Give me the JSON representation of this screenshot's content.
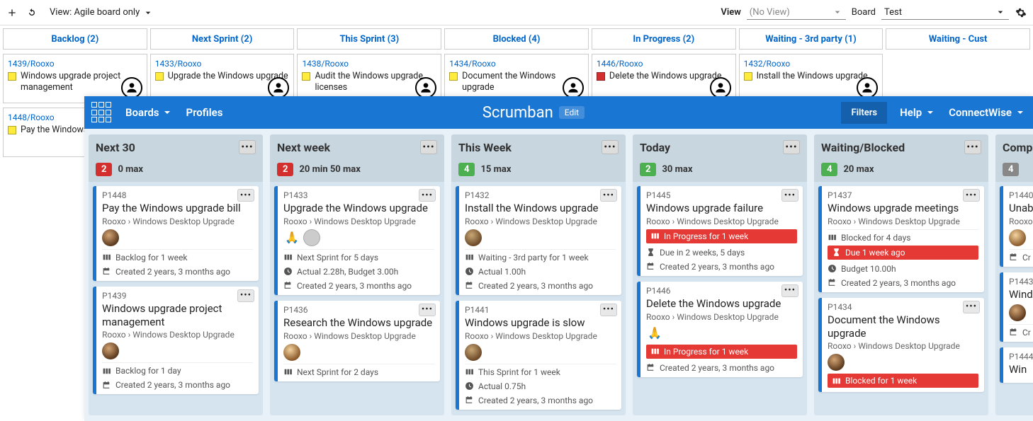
{
  "toolbar": {
    "view_text": "View: Agile board only",
    "right_view_label": "View",
    "right_view_value": "(No View)",
    "board_label": "Board",
    "board_value": "Test"
  },
  "agile_columns": [
    {
      "title": "Backlog (2)",
      "cards": [
        {
          "link": "1439/Rooxo",
          "chip": "#ffeb3b",
          "desc": "Windows upgrade project management"
        },
        {
          "link": "1448/Rooxo",
          "chip": "#ffeb3b",
          "desc": "Pay the Windows upgrade bill"
        }
      ]
    },
    {
      "title": "Next Sprint (2)",
      "cards": [
        {
          "link": "1433/Rooxo",
          "chip": "#ffeb3b",
          "desc": "Upgrade the Windows upgrade"
        }
      ]
    },
    {
      "title": "This Sprint (3)",
      "cards": [
        {
          "link": "1438/Rooxo",
          "chip": "#ffeb3b",
          "desc": "Audit the Windows upgrade licenses"
        }
      ]
    },
    {
      "title": "Blocked (4)",
      "cards": [
        {
          "link": "1434/Rooxo",
          "chip": "#ffeb3b",
          "desc": "Document the Windows upgrade"
        }
      ]
    },
    {
      "title": "In Progress (2)",
      "cards": [
        {
          "link": "1446/Rooxo",
          "chip": "#d32f2f",
          "desc": "Delete the Windows upgrade"
        }
      ]
    },
    {
      "title": "Waiting - 3rd party (1)",
      "cards": [
        {
          "link": "1432/Rooxo",
          "chip": "#ffeb3b",
          "desc": "Install the Windows upgrade"
        }
      ]
    },
    {
      "title": "Waiting - Cust",
      "cards": []
    }
  ],
  "scrumban": {
    "boards_label": "Boards",
    "profiles_label": "Profiles",
    "title": "Scrumban",
    "edit_label": "Edit",
    "filters_label": "Filters",
    "help_label": "Help",
    "cw_label": "ConnectWise",
    "columns": [
      {
        "title": "Next 30",
        "count": "2",
        "count_color": "red",
        "max": "0 max",
        "cards": [
          {
            "pid": "P1448",
            "title": "Pay the Windows upgrade bill",
            "crumb": "Rooxo › Windows Desktop Upgrade",
            "avs": [
              "a1"
            ],
            "metas": [
              {
                "icon": "col",
                "text": "Backlog for 1 week"
              },
              {
                "icon": "cal",
                "text": "Created 2 years, 3 months ago"
              }
            ]
          },
          {
            "pid": "P1439",
            "title": "Windows upgrade project management",
            "crumb": "Rooxo › Windows Desktop Upgrade",
            "avs": [
              "a1"
            ],
            "metas": [
              {
                "icon": "col",
                "text": "Backlog for 1 day"
              },
              {
                "icon": "cal",
                "text": "Created 2 years, 3 months ago"
              }
            ]
          }
        ]
      },
      {
        "title": "Next week",
        "count": "2",
        "count_color": "red",
        "max": "20 min 50 max",
        "cards": [
          {
            "pid": "P1433",
            "title": "Upgrade the Windows upgrade",
            "crumb": "Rooxo › Windows Desktop Upgrade",
            "avs": [
              "pray",
              "blank"
            ],
            "metas": [
              {
                "icon": "col",
                "text": "Next Sprint for 5 days"
              },
              {
                "icon": "clock",
                "text": "Actual 2.28h, Budget 3.00h"
              },
              {
                "icon": "cal",
                "text": "Created 2 years, 3 months ago"
              }
            ]
          },
          {
            "pid": "P1436",
            "title": "Research the Windows upgrade",
            "crumb": "Rooxo › Windows Desktop Upgrade",
            "avs": [
              "a2"
            ],
            "metas": [
              {
                "icon": "col",
                "text": "Next Sprint for 2 days"
              }
            ]
          }
        ]
      },
      {
        "title": "This Week",
        "count": "4",
        "count_color": "green",
        "max": "15 max",
        "cards": [
          {
            "pid": "P1432",
            "title": "Install the Windows upgrade",
            "crumb": "Rooxo › Windows Desktop Upgrade",
            "avs": [
              "a3"
            ],
            "metas": [
              {
                "icon": "col",
                "text": "Waiting - 3rd party for 1 week"
              },
              {
                "icon": "clock",
                "text": "Actual 1.00h"
              },
              {
                "icon": "cal",
                "text": "Created 2 years, 3 months ago"
              }
            ]
          },
          {
            "pid": "P1441",
            "title": "Windows upgrade is slow",
            "crumb": "Rooxo › Windows Desktop Upgrade",
            "avs": [
              "a3"
            ],
            "metas": [
              {
                "icon": "col",
                "text": "This Sprint for 1 week"
              },
              {
                "icon": "clock",
                "text": "Actual 0.75h"
              },
              {
                "icon": "cal",
                "text": "Created 2 years, 3 months ago"
              }
            ]
          }
        ]
      },
      {
        "title": "Today",
        "count": "2",
        "count_color": "green",
        "max": "30 max",
        "cards": [
          {
            "pid": "P1445",
            "title": "Windows upgrade failure",
            "crumb": "Rooxo › Windows Desktop Upgrade",
            "avs": [],
            "metas": [
              {
                "icon": "col",
                "text": "In Progress for 1 week",
                "red": true
              },
              {
                "icon": "hour",
                "text": "Due in 2 weeks, 5 days"
              },
              {
                "icon": "cal",
                "text": "Created 2 years, 3 months ago"
              }
            ]
          },
          {
            "pid": "P1446",
            "title": "Delete the Windows upgrade",
            "crumb": "Rooxo › Windows Desktop Upgrade",
            "avs": [
              "pray"
            ],
            "metas": [
              {
                "icon": "col",
                "text": "In Progress for 1 week",
                "red": true
              },
              {
                "icon": "cal",
                "text": "Created 2 years, 3 months ago"
              }
            ]
          }
        ]
      },
      {
        "title": "Waiting/Blocked",
        "count": "4",
        "count_color": "green",
        "max": "20 max",
        "cards": [
          {
            "pid": "P1437",
            "title": "Windows upgrade meetings",
            "crumb": "Rooxo › Windows Desktop Upgrade",
            "avs": [],
            "metas": [
              {
                "icon": "col",
                "text": "Blocked for 4 days"
              },
              {
                "icon": "hour",
                "text": "Due 1 week ago",
                "red": true
              },
              {
                "icon": "clock",
                "text": "Budget 10.00h"
              },
              {
                "icon": "cal",
                "text": "Created 2 years, 3 months ago"
              }
            ]
          },
          {
            "pid": "P1434",
            "title": "Document the Windows upgrade",
            "crumb": "Rooxo › Windows Desktop Upgrade",
            "avs": [
              "a1"
            ],
            "metas": [
              {
                "icon": "col",
                "text": "Blocked for 1 week",
                "red": true
              }
            ]
          }
        ]
      },
      {
        "title": "Comp",
        "count": "4",
        "count_color": "gray",
        "max": "",
        "cards": [
          {
            "pid": "P1440",
            "title": "Unab upgr",
            "crumb": "Rooxo",
            "avs": [
              "a2"
            ],
            "metas": [
              {
                "icon": "cal",
                "text": "Cr"
              }
            ]
          },
          {
            "pid": "P1443",
            "title": "Wind error",
            "crumb": "",
            "avs": [
              "a1"
            ],
            "metas": [
              {
                "icon": "cal",
                "text": "Cr"
              }
            ]
          },
          {
            "pid": "P1444",
            "title": "Win",
            "crumb": "",
            "avs": [],
            "metas": []
          }
        ]
      }
    ]
  }
}
